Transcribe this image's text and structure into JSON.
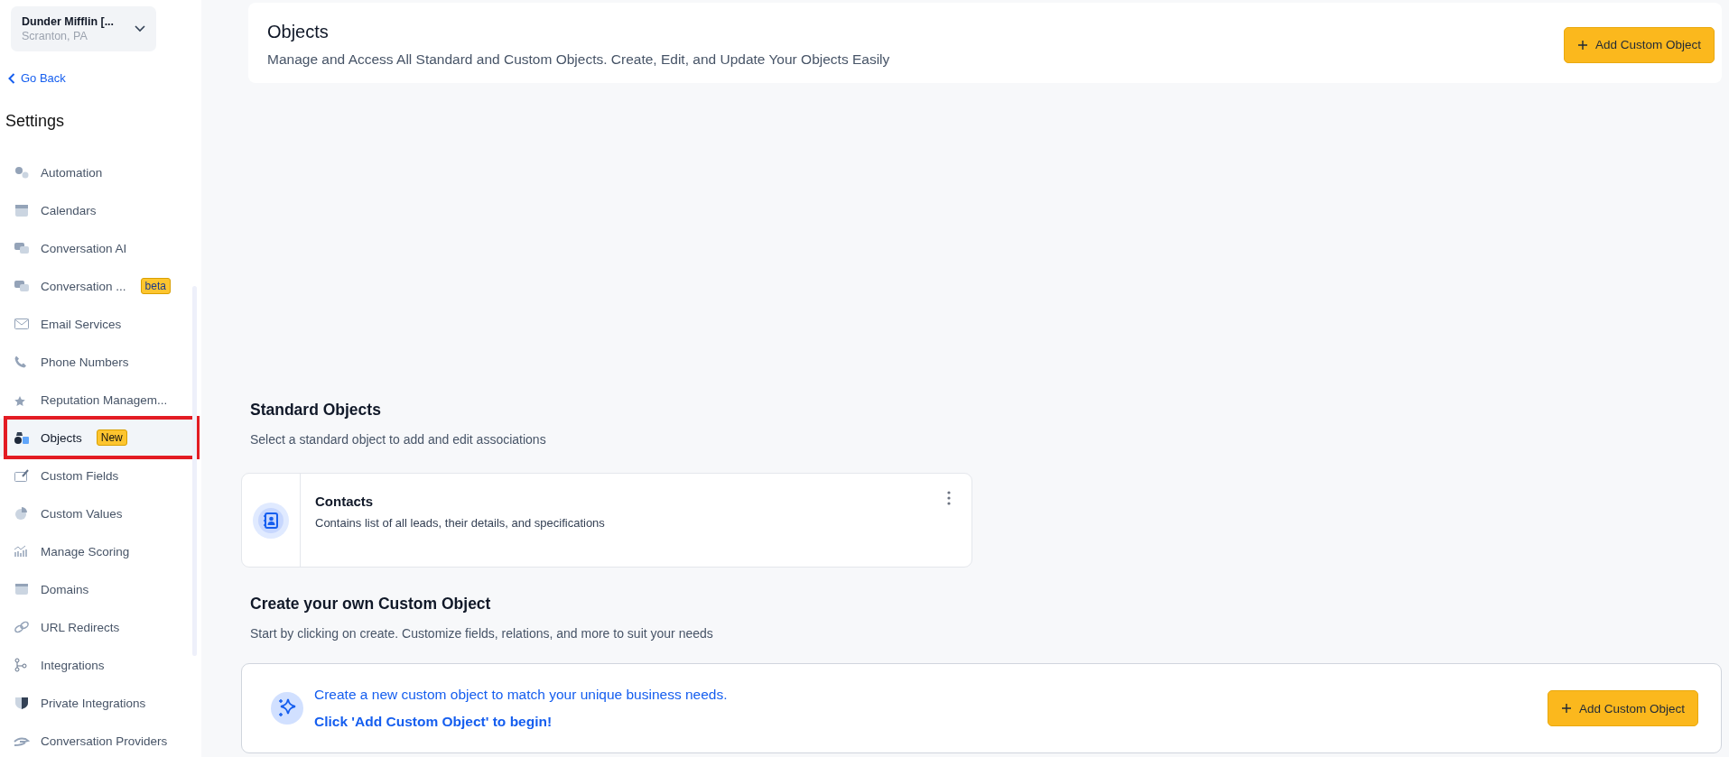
{
  "account": {
    "name": "Dunder Mifflin [...",
    "location": "Scranton, PA"
  },
  "back_link": "Go Back",
  "sidebar": {
    "title": "Settings",
    "items": [
      {
        "label": "Automation",
        "selected": false
      },
      {
        "label": "Calendars",
        "selected": false
      },
      {
        "label": "Conversation AI",
        "selected": false
      },
      {
        "label": "Conversation ...",
        "selected": false,
        "badge": "beta"
      },
      {
        "label": "Email Services",
        "selected": false
      },
      {
        "label": "Phone Numbers",
        "selected": false
      },
      {
        "label": "Reputation Managem...",
        "selected": false
      },
      {
        "label": "Objects",
        "selected": true,
        "badge": "New"
      },
      {
        "label": "Custom Fields",
        "selected": false
      },
      {
        "label": "Custom Values",
        "selected": false
      },
      {
        "label": "Manage Scoring",
        "selected": false
      },
      {
        "label": "Domains",
        "selected": false
      },
      {
        "label": "URL Redirects",
        "selected": false
      },
      {
        "label": "Integrations",
        "selected": false
      },
      {
        "label": "Private Integrations",
        "selected": false
      },
      {
        "label": "Conversation Providers",
        "selected": false
      }
    ]
  },
  "header": {
    "title": "Objects",
    "subtitle": "Manage and Access All Standard and Custom Objects. Create, Edit, and Update Your Objects Easily",
    "button": "Add Custom Object"
  },
  "standard_objects": {
    "title": "Standard Objects",
    "subtitle": "Select a standard object to add and edit associations",
    "cards": [
      {
        "title": "Contacts",
        "description": "Contains list of all leads, their details, and specifications"
      }
    ]
  },
  "custom_objects": {
    "title": "Create your own Custom Object",
    "subtitle": "Start by clicking on create. Customize fields, relations, and more to suit your needs",
    "banner_text": "Create a new custom object to match your unique business needs. **Click 'Add Custom Object' to begin!**",
    "button": "Add Custom Object"
  }
}
